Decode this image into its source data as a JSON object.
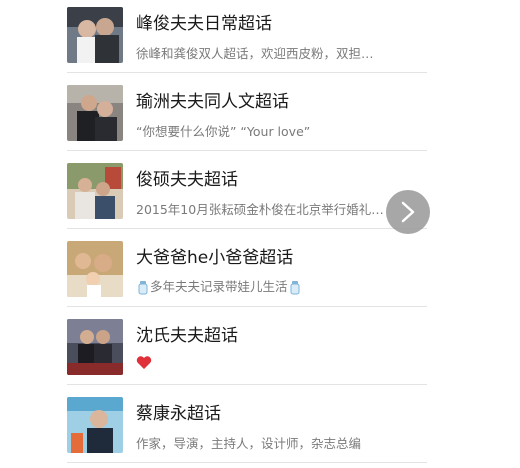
{
  "topics": [
    {
      "title": "峰俊夫夫日常超话",
      "subtitle": "徐峰和龚俊双人超话，欢迎西皮粉，双担…",
      "image": "couple-photo-1"
    },
    {
      "title": "瑜洲夫夫同人文超话",
      "subtitle": "“你想要什么你说” “Your love”",
      "image": "couple-photo-2"
    },
    {
      "title": "俊硕夫夫超话",
      "subtitle": "2015年10月张耘硕金朴俊在北京举行婚礼…",
      "image": "wedding-photo"
    },
    {
      "title": "大爸爸he小爸爸超话",
      "subtitle": "多年夫夫记录带娃儿生活",
      "subtitle_icon": "baby-bottle-icon",
      "image": "family-photo"
    },
    {
      "title": "沈氏夫夫超话",
      "subtitle": "",
      "subtitle_icon": "heart-icon",
      "image": "couple-photo-3"
    },
    {
      "title": "蔡康永超话",
      "subtitle": "作家，导演，主持人，设计师，杂志总编",
      "image": "portrait-photo"
    }
  ],
  "overlay": {
    "icon": "chevron-right-icon"
  },
  "colors": {
    "title": "#1a1a1a",
    "subtitle": "#7a7a7a",
    "divider": "#e3e3e3",
    "heart": "#e0313b"
  }
}
